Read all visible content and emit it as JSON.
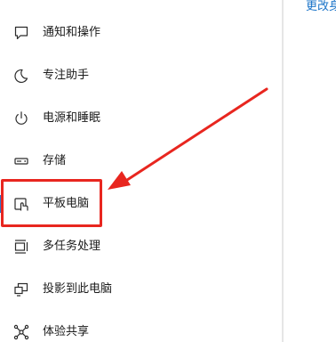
{
  "content": {
    "link_text": "更改身"
  },
  "nav": {
    "items": [
      {
        "label": "通知和操作",
        "icon": "notification-icon"
      },
      {
        "label": "专注助手",
        "icon": "moon-icon"
      },
      {
        "label": "电源和睡眠",
        "icon": "power-icon"
      },
      {
        "label": "存储",
        "icon": "storage-icon"
      },
      {
        "label": "平板电脑",
        "icon": "tablet-icon",
        "selected": true
      },
      {
        "label": "多任务处理",
        "icon": "multitasking-icon"
      },
      {
        "label": "投影到此电脑",
        "icon": "projection-icon"
      },
      {
        "label": "体验共享",
        "icon": "share-icon"
      }
    ]
  },
  "annotation": {
    "highlight_color": "#e8261f"
  }
}
